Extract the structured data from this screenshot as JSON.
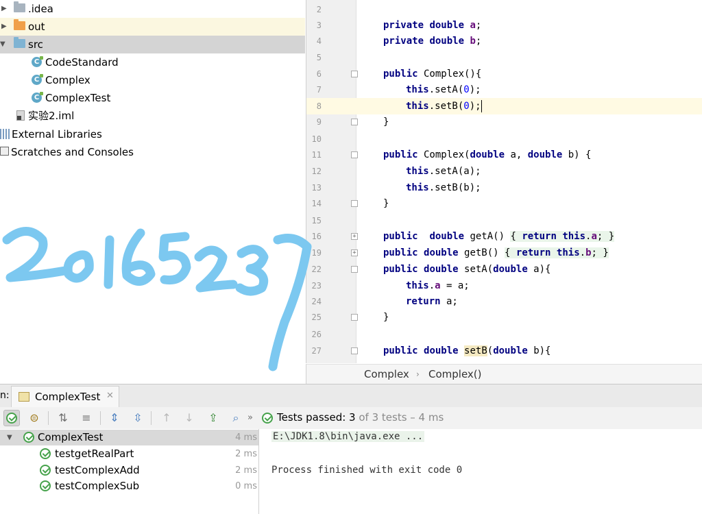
{
  "project_tree": {
    "items": [
      {
        "label": ".idea",
        "icon": "folder-icon",
        "color": "#a8b4bf"
      },
      {
        "label": "out",
        "icon": "folder-icon",
        "color": "#f0a04a"
      },
      {
        "label": "src",
        "icon": "folder-icon",
        "color": "#7fb3d3"
      },
      {
        "label": "CodeStandard",
        "icon": "java-class-icon"
      },
      {
        "label": "Complex",
        "icon": "java-class-icon"
      },
      {
        "label": "ComplexTest",
        "icon": "java-class-icon"
      },
      {
        "label": "实验2.iml",
        "icon": "iml-file-icon"
      },
      {
        "label": "External Libraries",
        "icon": "libraries-icon"
      },
      {
        "label": "Scratches and Consoles",
        "icon": "scratches-icon"
      }
    ]
  },
  "editor": {
    "lines": [
      {
        "n": "2",
        "code": ""
      },
      {
        "n": "3",
        "code": "private double a;"
      },
      {
        "n": "4",
        "code": "private double b;"
      },
      {
        "n": "5",
        "code": ""
      },
      {
        "n": "6",
        "code": "public Complex(){"
      },
      {
        "n": "7",
        "code": "this.setA(0);"
      },
      {
        "n": "8",
        "code": "this.setB(0);"
      },
      {
        "n": "9",
        "code": "}"
      },
      {
        "n": "10",
        "code": ""
      },
      {
        "n": "11",
        "code": "public Complex(double a, double b) {"
      },
      {
        "n": "12",
        "code": "this.setA(a);"
      },
      {
        "n": "13",
        "code": "this.setB(b);"
      },
      {
        "n": "14",
        "code": "}"
      },
      {
        "n": "15",
        "code": ""
      },
      {
        "n": "16",
        "code": "public  double getA() { return this.a; }"
      },
      {
        "n": "19",
        "code": "public double getB() { return this.b; }"
      },
      {
        "n": "22",
        "code": "public double setA(double a){"
      },
      {
        "n": "23",
        "code": "this.a = a;"
      },
      {
        "n": "24",
        "code": "return a;"
      },
      {
        "n": "25",
        "code": "}"
      },
      {
        "n": "26",
        "code": ""
      },
      {
        "n": "27",
        "code": "public double setB(double b){"
      }
    ],
    "breadcrumbs": [
      "Complex",
      "Complex()"
    ]
  },
  "run": {
    "label": "n:",
    "tab": "ComplexTest",
    "status_main": "Tests passed: 3",
    "status_detail": " of 3 tests – 4 ms",
    "tests": [
      {
        "name": "ComplexTest",
        "time": "4 ms"
      },
      {
        "name": "testgetRealPart",
        "time": "2 ms"
      },
      {
        "name": "testComplexAdd",
        "time": "2 ms"
      },
      {
        "name": "testComplexSub",
        "time": "0 ms"
      }
    ],
    "console": [
      "E:\\JDK1.8\\bin\\java.exe ...",
      "Process finished with exit code 0"
    ]
  },
  "handwriting": "20165237",
  "colors": {
    "keyword": "#000080",
    "field": "#660e7a",
    "number": "#0000ff",
    "pass": "#46a24b",
    "annotation": "#7cc8f0"
  }
}
